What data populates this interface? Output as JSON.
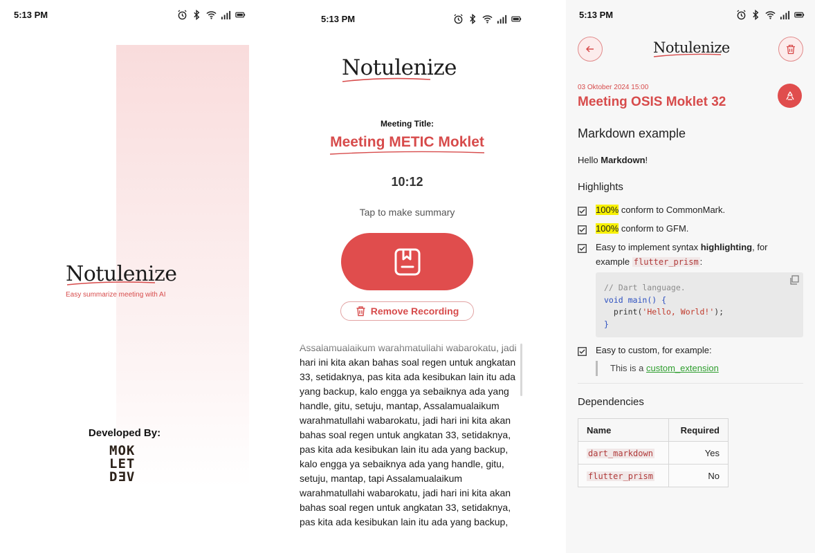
{
  "status_bar": {
    "time": "5:13 PM",
    "icons": [
      "alarm-icon",
      "bluetooth-icon",
      "wifi-icon",
      "signal-icon",
      "battery-icon"
    ]
  },
  "colors": {
    "accent": "#d74b4b",
    "button": "#e04d4d",
    "highlight": "#f7f000",
    "link": "#2e9e2e"
  },
  "splash": {
    "logo": "Notulenize",
    "tagline": "Easy summarize meeting with AI",
    "developed_by": "Developed By:",
    "dev_logo": [
      "MOK",
      "LET",
      "DƎV"
    ]
  },
  "record": {
    "logo": "Notulenize",
    "meeting_title_label": "Meeting Title:",
    "meeting_title": "Meeting METIC Moklet",
    "timer": "10:12",
    "tap_hint": "Tap to make summary",
    "summarize_icon": "bookmark-document-icon",
    "remove_label": "Remove Recording",
    "transcript": "Assalamualaikum warahmatullahi wabarokatu, jadi hari ini kita akan bahas soal regen untuk angkatan 33, setidaknya, pas kita ada kesibukan lain itu ada yang backup, kalo engga ya sebaiknya ada yang handle, gitu, setuju, mantap, Assalamualaikum warahmatullahi wabarokatu, jadi hari ini kita akan bahas soal regen untuk angkatan 33, setidaknya, pas kita ada kesibukan lain itu ada yang backup, kalo engga ya sebaiknya ada yang handle, gitu, setuju, mantap, tapi Assalamualaikum warahmatullahi wabarokatu, jadi hari ini kita akan bahas soal regen untuk angkatan 33, setidaknya, pas kita ada kesibukan lain itu ada yang backup,"
  },
  "detail": {
    "logo": "Notulenize",
    "date": "03 Oktober 2024 15:00",
    "title": "Meeting OSIS Moklet 32",
    "h1": "Markdown example",
    "hello_prefix": "Hello ",
    "hello_bold": "Markdown",
    "hello_suffix": "!",
    "h2": "Highlights",
    "list": {
      "item1_hl": "100%",
      "item1_text": " conform to CommonMark.",
      "item2_hl": "100%",
      "item2_text": " conform to GFM.",
      "item3_a": "Easy to implement syntax ",
      "item3_bold": "highlighting",
      "item3_b": ", for example ",
      "item3_code": "flutter_prism",
      "item3_c": ":",
      "item4": "Easy to custom, for example:"
    },
    "code": {
      "comment": "// Dart language.",
      "l2_kw": "void",
      "l2_rest": " main() {",
      "l3_a": "  print(",
      "l3_str": "'Hello, World!'",
      "l3_b": ");",
      "l4": "}"
    },
    "quote_prefix": "This is a ",
    "quote_link": "custom_extension",
    "h3": "Dependencies",
    "table": {
      "headers": [
        "Name",
        "Required"
      ],
      "rows": [
        {
          "name": "dart_markdown",
          "required": "Yes"
        },
        {
          "name": "flutter_prism",
          "required": "No"
        }
      ]
    }
  }
}
